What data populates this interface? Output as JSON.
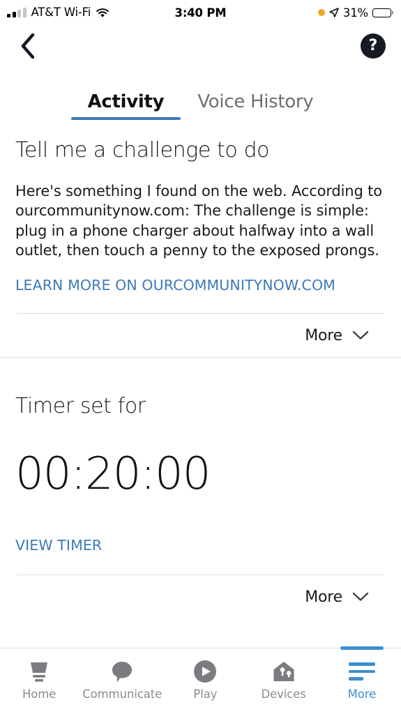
{
  "statusbar": {
    "carrier": "AT&T Wi-Fi",
    "time": "3:40 PM",
    "battery_percent": "31%",
    "battery_level": 31,
    "signal_icon": "cellular-signal-icon",
    "wifi_icon": "wifi-icon",
    "recording_dot_icon": "orange-recording-dot-icon",
    "location_icon": "location-arrow-icon",
    "battery_icon": "battery-icon"
  },
  "navbar": {
    "back_icon": "back-chevron-icon",
    "help_icon": "help-question-icon",
    "help_glyph": "?"
  },
  "tabs": {
    "items": [
      {
        "label": "Activity",
        "active": true
      },
      {
        "label": "Voice History",
        "active": false
      }
    ]
  },
  "cards": [
    {
      "title": "Tell me a challenge to do",
      "body": "Here's something I found on the web. According to ourcommunitynow.com: The challenge is simple: plug in a phone charger about halfway into a wall outlet, then touch a penny to the exposed prongs.",
      "link": "LEARN MORE ON OURCOMMUNITYNOW.COM",
      "more_label": "More",
      "more_icon": "chevron-down-icon"
    },
    {
      "title": "Timer set for",
      "value": "00:20:00",
      "link": "VIEW TIMER",
      "more_label": "More",
      "more_icon": "chevron-down-icon"
    }
  ],
  "bottom_nav": {
    "items": [
      {
        "label": "Home",
        "icon": "echo-device-icon",
        "active": false
      },
      {
        "label": "Communicate",
        "icon": "speech-bubble-icon",
        "active": false
      },
      {
        "label": "Play",
        "icon": "play-circle-icon",
        "active": false
      },
      {
        "label": "Devices",
        "icon": "smart-home-icon",
        "active": false
      },
      {
        "label": "More",
        "icon": "hamburger-menu-icon",
        "active": true
      }
    ]
  },
  "colors": {
    "accent_blue": "#3d7ab8",
    "tab_active_blue": "#3d8fd0",
    "icon_gray": "#7c7c80",
    "text_primary": "#1a1a1a",
    "text_muted": "#8b8b8e",
    "battery_orange": "#f5a623"
  }
}
